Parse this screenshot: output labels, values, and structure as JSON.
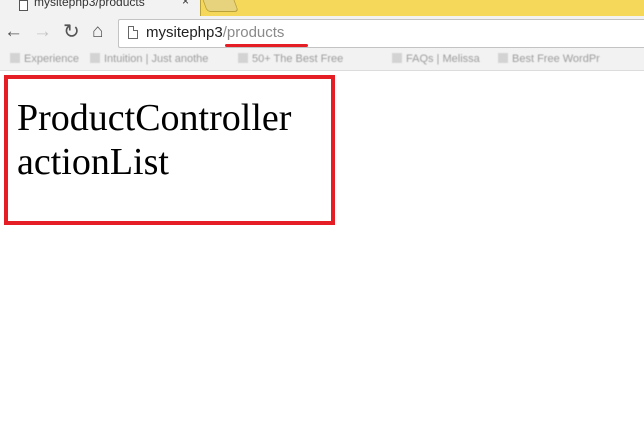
{
  "browser": {
    "tab": {
      "title": "mysitephp3/products",
      "close_glyph": "×"
    },
    "toolbar": {
      "back_icon": "back-arrow-icon",
      "forward_icon": "forward-arrow-icon",
      "reload_icon": "reload-icon",
      "home_icon": "home-icon"
    },
    "address_bar": {
      "host": "mysitephp3",
      "path": "/products"
    },
    "bookmarks": [
      {
        "label": "Experience"
      },
      {
        "label": "Intuition | Just anothe"
      },
      {
        "label": "50+ The Best Free"
      },
      {
        "label": "FAQs | Melissa"
      },
      {
        "label": "Best Free WordPr"
      }
    ]
  },
  "page": {
    "lines": [
      "ProductController",
      "actionList"
    ]
  },
  "colors": {
    "tabstrip": "#f5d85a",
    "annotation_red": "#e51e25",
    "url_path_gray": "#8a8a8a"
  }
}
